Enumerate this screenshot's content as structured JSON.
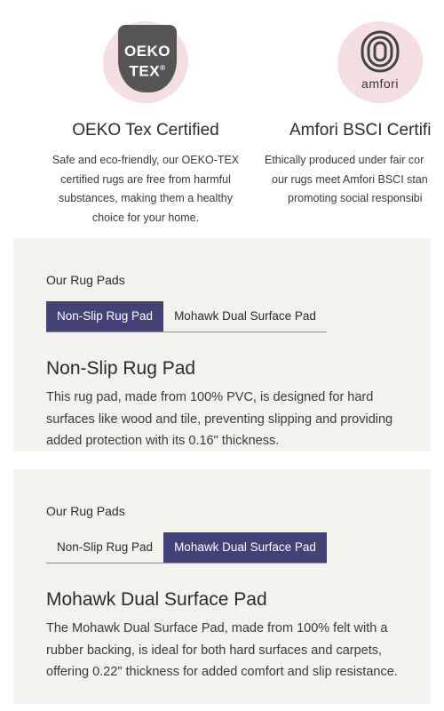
{
  "certifications": [
    {
      "logo_text_line1": "OEKO",
      "logo_text_line2": "TEX",
      "logo_mark": "®",
      "title": "OEKO Tex Certified",
      "description": "Safe and eco-friendly, our OEKO-TEX certified rugs are free from harmful substances, making them a healthy choice for your home."
    },
    {
      "logo_word": "amfori",
      "title": "Amfori BSCI Certifi",
      "description_lines": [
        "Ethically produced under fair cor",
        "our rugs meet Amfori BSCI stan",
        "promoting social responsibi"
      ]
    }
  ],
  "panels": [
    {
      "label": "Our Rug Pads",
      "tabs": [
        "Non-Slip Rug Pad",
        "Mohawk Dual Surface Pad"
      ],
      "active_tab": 0,
      "heading": "Non-Slip Rug Pad",
      "text": "This rug pad, made from 100% PVC, is designed for hard surfaces like wood and tile, preventing slipping and providing added protection with its 0.16\" thickness."
    },
    {
      "label": "Our Rug Pads",
      "tabs": [
        "Non-Slip Rug Pad",
        "Mohawk Dual Surface Pad"
      ],
      "active_tab": 1,
      "heading": "Mohawk Dual Surface Pad",
      "text": "The Mohawk Dual Surface Pad, made from 100% felt with a rubber backing, is ideal for both hard surfaces and carpets, offering 0.22\" thickness for added comfort and slip resistance."
    }
  ],
  "colors": {
    "active_tab_bg": "#434277",
    "panel_bg": "#f3f2ef",
    "logo_blob": "#f6dfe0"
  }
}
